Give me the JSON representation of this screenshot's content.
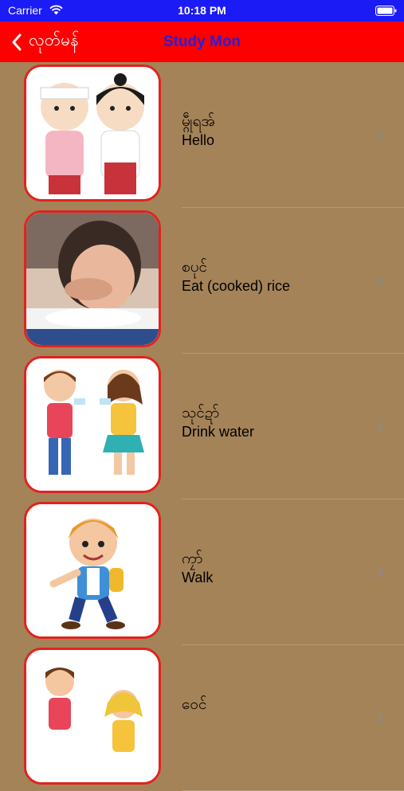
{
  "status_bar": {
    "carrier": "Carrier",
    "time": "10:18 PM",
    "icons": [
      "wifi-icon",
      "battery-icon"
    ]
  },
  "nav": {
    "back_label": "လုတ်မန်",
    "title": "Study Mon",
    "back_icon": "chevron-left-icon"
  },
  "colors": {
    "status_bar": "#1b1bf5",
    "nav_bar": "#ff0000",
    "nav_title": "#2a1fd8",
    "background": "#a58358",
    "thumb_border": "#e0231e"
  },
  "rows": [
    {
      "mon": "မ္ဂဵုရအ်",
      "en": "Hello",
      "image": "two-children-greeting-image"
    },
    {
      "mon": "စပုင်",
      "en": " Eat (cooked) rice",
      "image": "girl-eating-rice-image"
    },
    {
      "mon": "သုင်ဍာ်",
      "en": "Drink water",
      "image": "children-drinking-water-image"
    },
    {
      "mon": "ကၠာ်",
      "en": "Walk",
      "image": "boy-walking-image"
    },
    {
      "mon": "ဝေင်",
      "en": "",
      "image": "children-image"
    }
  ]
}
